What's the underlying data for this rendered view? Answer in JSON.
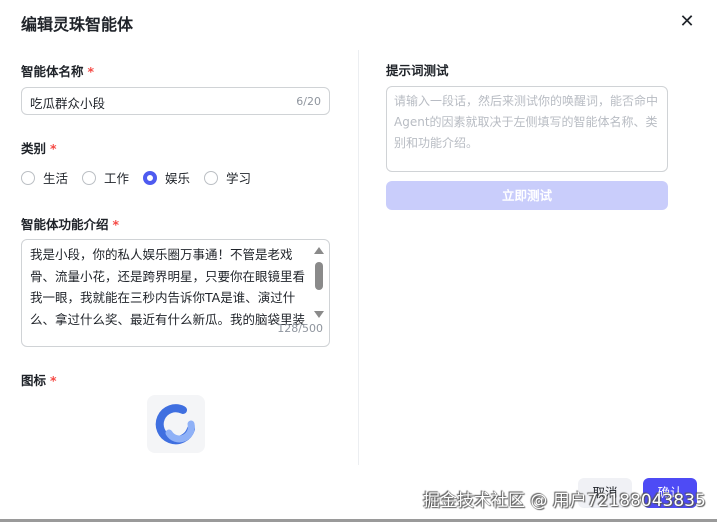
{
  "dialog": {
    "title": "编辑灵珠智能体",
    "close_icon": "close-icon"
  },
  "name_field": {
    "label": "智能体名称",
    "required": "*",
    "value": "吃瓜群众小段",
    "count": "6/20"
  },
  "category": {
    "label": "类别",
    "required": "*",
    "options": [
      {
        "label": "生活",
        "selected": false
      },
      {
        "label": "工作",
        "selected": false
      },
      {
        "label": "娱乐",
        "selected": true
      },
      {
        "label": "学习",
        "selected": false
      }
    ]
  },
  "intro": {
    "label": "智能体功能介绍",
    "required": "*",
    "value": "我是小段，你的私人娱乐圈万事通！不管是老戏骨、流量小花，还是跨界明星，只要你在眼镜里看我一眼，我就能在三秒内告诉你TA是谁、演过什么、拿过什么奖、最近有什么新瓜。我的脑袋里装",
    "count": "128/500"
  },
  "icon_field": {
    "label": "图标",
    "required": "*"
  },
  "prompt_test": {
    "label": "提示词测试",
    "placeholder": "请输入一段话，然后来测试你的唤醒词，能否命中Agent的因素就取决于左侧填写的智能体名称、类别和功能介绍。",
    "button": "立即测试"
  },
  "footer": {
    "cancel": "取消",
    "confirm": "确认"
  },
  "watermark": "掘金技术社区 @ 用户72188043835",
  "colors": {
    "accent": "#4e4bf5",
    "required": "#f54a45",
    "disabled": "#c9cdfb"
  }
}
